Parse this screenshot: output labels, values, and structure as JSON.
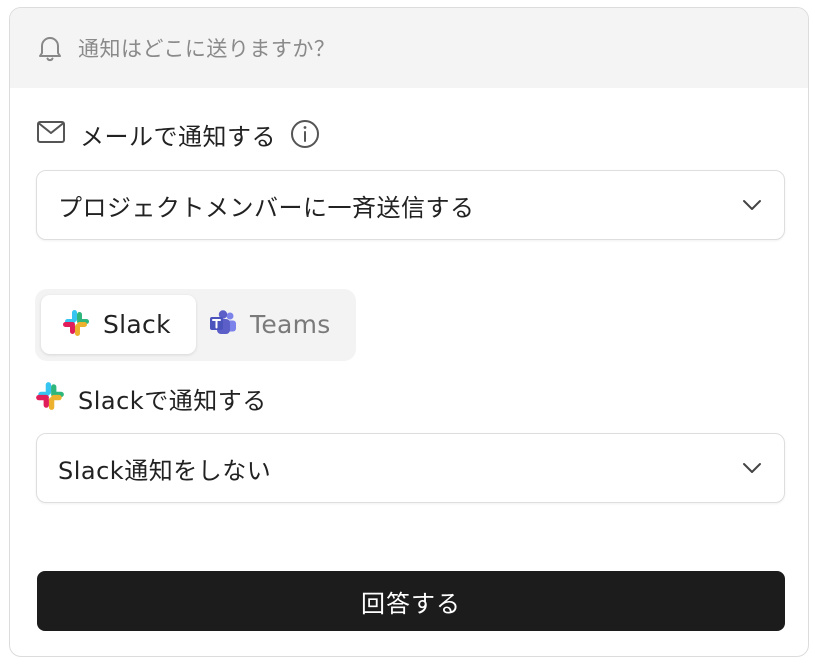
{
  "header": {
    "icon": "bell-icon",
    "question": "通知はどこに送りますか？"
  },
  "email": {
    "icon": "mail-icon",
    "label": "メールで通知する",
    "info_icon": "info-icon",
    "selected": "プロジェクトメンバーに一斉送信する"
  },
  "tabs": [
    {
      "label": "Slack",
      "icon": "slack-icon",
      "active": true
    },
    {
      "label": "Teams",
      "icon": "teams-icon",
      "active": false
    }
  ],
  "slack": {
    "icon": "slack-icon",
    "label": "Slackで通知する",
    "selected": "Slack通知をしない"
  },
  "submit": {
    "label": "回答する"
  },
  "colors": {
    "header_bg": "#f4f4f4",
    "button_bg": "#1c1c1c",
    "muted_text": "#8a8a8a",
    "border": "#dedede",
    "slack_blue": "#36c5f0",
    "slack_green": "#2eb67d",
    "slack_yellow": "#ecb22e",
    "slack_red": "#e01e5a",
    "teams_purple": "#5b5fc7"
  }
}
